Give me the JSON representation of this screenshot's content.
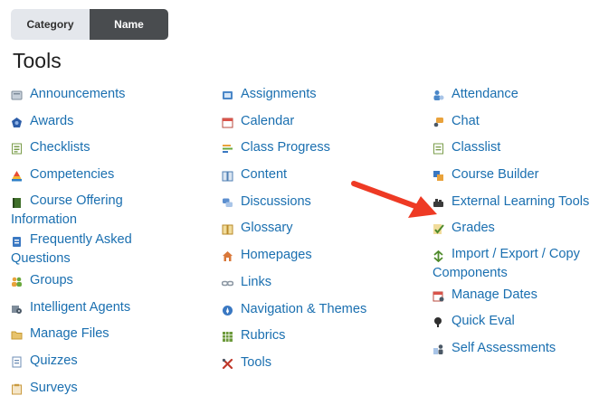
{
  "toggle": {
    "left_label": "Category",
    "right_label": "Name",
    "selected": "Name"
  },
  "heading": "Tools",
  "columns": [
    [
      {
        "label": "Announcements",
        "icon": "announcements-icon"
      },
      {
        "label": "Awards",
        "icon": "awards-icon"
      },
      {
        "label": "Checklists",
        "icon": "checklists-icon"
      },
      {
        "label": "Competencies",
        "icon": "competencies-icon"
      },
      {
        "label": "Course Offering Information",
        "icon": "course-info-icon"
      },
      {
        "label": "Frequently Asked Questions",
        "icon": "faq-icon"
      },
      {
        "label": "Groups",
        "icon": "groups-icon"
      },
      {
        "label": "Intelligent Agents",
        "icon": "intelligent-agents-icon"
      },
      {
        "label": "Manage Files",
        "icon": "folder-icon"
      },
      {
        "label": "Quizzes",
        "icon": "quizzes-icon"
      },
      {
        "label": "Surveys",
        "icon": "surveys-icon"
      }
    ],
    [
      {
        "label": "Assignments",
        "icon": "assignments-icon"
      },
      {
        "label": "Calendar",
        "icon": "calendar-icon"
      },
      {
        "label": "Class Progress",
        "icon": "class-progress-icon"
      },
      {
        "label": "Content",
        "icon": "content-icon"
      },
      {
        "label": "Discussions",
        "icon": "discussions-icon"
      },
      {
        "label": "Glossary",
        "icon": "glossary-icon"
      },
      {
        "label": "Homepages",
        "icon": "home-icon"
      },
      {
        "label": "Links",
        "icon": "links-icon"
      },
      {
        "label": "Navigation & Themes",
        "icon": "navigation-icon"
      },
      {
        "label": "Rubrics",
        "icon": "rubrics-icon"
      },
      {
        "label": "Tools",
        "icon": "tools-icon"
      }
    ],
    [
      {
        "label": "Attendance",
        "icon": "attendance-icon"
      },
      {
        "label": "Chat",
        "icon": "chat-icon"
      },
      {
        "label": "Classlist",
        "icon": "classlist-icon"
      },
      {
        "label": "Course Builder",
        "icon": "course-builder-icon"
      },
      {
        "label": "External Learning Tools",
        "icon": "external-tools-icon"
      },
      {
        "label": "Grades",
        "icon": "grades-icon"
      },
      {
        "label": "Import / Export / Copy Components",
        "icon": "import-export-icon"
      },
      {
        "label": "Manage Dates",
        "icon": "manage-dates-icon"
      },
      {
        "label": "Quick Eval",
        "icon": "quick-eval-icon"
      },
      {
        "label": "Self Assessments",
        "icon": "self-assessments-icon"
      }
    ]
  ],
  "annotation": {
    "icon": "red-arrow-icon",
    "color": "#ee3a24"
  },
  "colors": {
    "link": "#1a6fb0",
    "toggle_active": "#494c4f",
    "toggle_inactive": "#e4e7ec"
  }
}
